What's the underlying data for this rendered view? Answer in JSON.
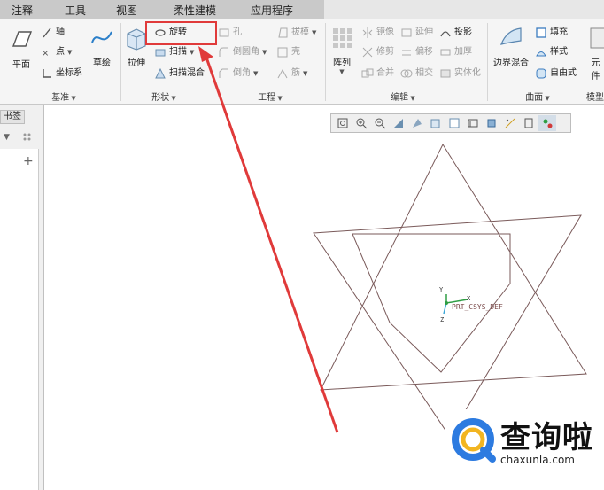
{
  "tabs": [
    "注释",
    "工具",
    "视图",
    "柔性建模",
    "应用程序"
  ],
  "groups": {
    "datum": {
      "label": "基准",
      "plane": "平面",
      "axis": "轴",
      "point": "点",
      "csys": "坐标系",
      "sketch": "草绘"
    },
    "shapes": {
      "label": "形状",
      "extrude": "拉伸",
      "revolve": "旋转",
      "sweep": "扫描",
      "swept_blend": "扫描混合"
    },
    "engineering": {
      "label": "工程",
      "hole": "孔",
      "round": "倒圆角",
      "chamfer": "倒角",
      "draft": "拔模",
      "shell": "壳",
      "rib": "筋"
    },
    "editing": {
      "label": "编辑",
      "pattern": "阵列",
      "mirror": "镜像",
      "trim": "修剪",
      "merge": "合并",
      "extend": "延伸",
      "offset": "偏移",
      "intersect": "相交",
      "project": "投影",
      "thicken": "加厚",
      "solidify": "实体化"
    },
    "surfaces": {
      "label": "曲面",
      "boundary_blend": "边界混合",
      "fill": "填充",
      "style": "样式",
      "freestyle": "自由式"
    },
    "model_intent": {
      "label": "模型",
      "component": "元件"
    }
  },
  "left_panel": {
    "tab": "书签"
  },
  "canvas": {
    "csys_label": "PRT_CSYS_DEF",
    "axis_x": "X",
    "axis_y": "Y",
    "axis_z": "Z"
  },
  "watermark": {
    "brand": "查询啦",
    "url": "chaxunla.com"
  },
  "colors": {
    "accent_red": "#e03a3a",
    "sketch_line": "#7a5a5a",
    "ribbon_bg": "#f5f5f5"
  }
}
